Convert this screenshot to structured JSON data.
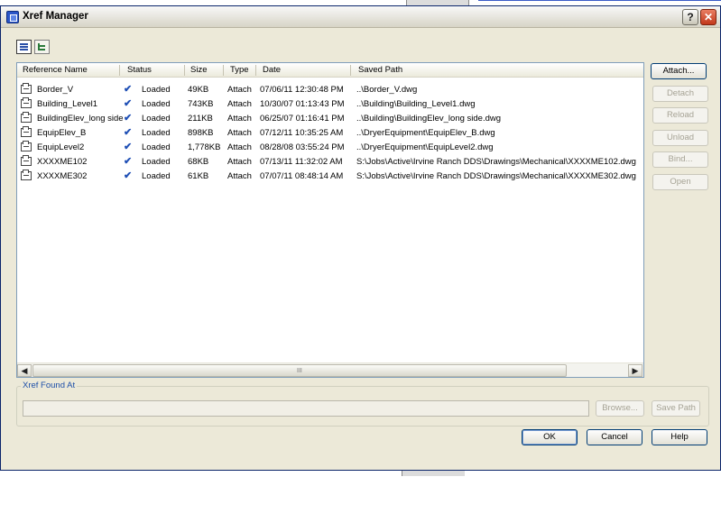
{
  "window": {
    "title": "Xref Manager",
    "help_label": "?",
    "close_label": "✕"
  },
  "columns": [
    "Reference Name",
    "Status",
    "Size",
    "Type",
    "Date",
    "Saved Path"
  ],
  "rows": [
    {
      "name": "Border_V",
      "status": "Loaded",
      "size": "49KB",
      "type": "Attach",
      "date": "07/06/11  12:30:48 PM",
      "path": "..\\Border_V.dwg"
    },
    {
      "name": "Building_Level1",
      "status": "Loaded",
      "size": "743KB",
      "type": "Attach",
      "date": "10/30/07  01:13:43 PM",
      "path": "..\\Building\\Building_Level1.dwg"
    },
    {
      "name": "BuildingElev_long side",
      "status": "Loaded",
      "size": "211KB",
      "type": "Attach",
      "date": "06/25/07  01:16:41 PM",
      "path": "..\\Building\\BuildingElev_long side.dwg"
    },
    {
      "name": "EquipElev_B",
      "status": "Loaded",
      "size": "898KB",
      "type": "Attach",
      "date": "07/12/11  10:35:25 AM",
      "path": "..\\DryerEquipment\\EquipElev_B.dwg"
    },
    {
      "name": "EquipLevel2",
      "status": "Loaded",
      "size": "1,778KB",
      "type": "Attach",
      "date": "08/28/08  03:55:24 PM",
      "path": "..\\DryerEquipment\\EquipLevel2.dwg"
    },
    {
      "name": "XXXXME102",
      "status": "Loaded",
      "size": "68KB",
      "type": "Attach",
      "date": "07/13/11  11:32:02 AM",
      "path": "S:\\Jobs\\Active\\Irvine Ranch DDS\\Drawings\\Mechanical\\XXXXME102.dwg"
    },
    {
      "name": "XXXXME302",
      "status": "Loaded",
      "size": "61KB",
      "type": "Attach",
      "date": "07/07/11  08:48:14 AM",
      "path": "S:\\Jobs\\Active\\Irvine Ranch DDS\\Drawings\\Mechanical\\XXXXME302.dwg"
    }
  ],
  "side_buttons": {
    "attach": "Attach...",
    "detach": "Detach",
    "reload": "Reload",
    "unload": "Unload",
    "bind": "Bind...",
    "open": "Open"
  },
  "found_at": {
    "label": "Xref Found At",
    "value": "",
    "browse": "Browse...",
    "save_path": "Save Path"
  },
  "footer": {
    "ok": "OK",
    "cancel": "Cancel",
    "help": "Help"
  },
  "scroll": {
    "left_arrow": "◀",
    "right_arrow": "▶",
    "grip": "III"
  }
}
